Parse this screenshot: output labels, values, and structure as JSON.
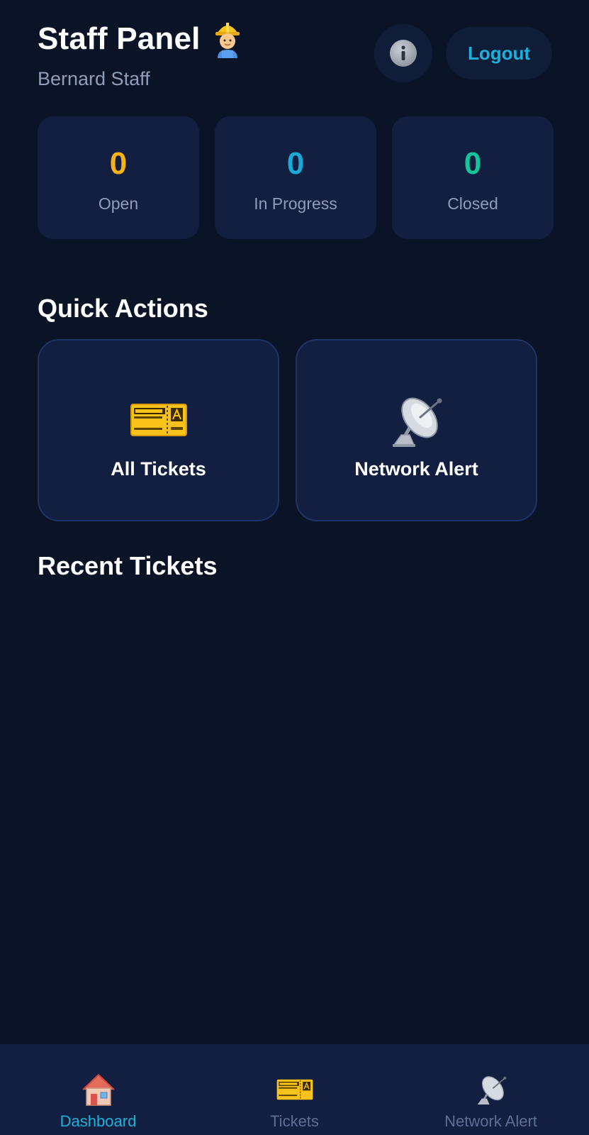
{
  "header": {
    "title": "Staff Panel",
    "title_icon": "construction-worker-emoji",
    "subtitle": "Bernard Staff",
    "info_icon": "info-icon",
    "logout_label": "Logout"
  },
  "stats": [
    {
      "value": "0",
      "label": "Open",
      "color": "#f5b315"
    },
    {
      "value": "0",
      "label": "In Progress",
      "color": "#1aa9d6"
    },
    {
      "value": "0",
      "label": "Closed",
      "color": "#14c49a"
    }
  ],
  "quick_actions": {
    "title": "Quick Actions",
    "items": [
      {
        "label": "All Tickets",
        "icon": "ticket-icon"
      },
      {
        "label": "Network Alert",
        "icon": "satellite-dish-icon"
      }
    ]
  },
  "recent_tickets": {
    "title": "Recent Tickets",
    "items": []
  },
  "bottom_nav": {
    "items": [
      {
        "label": "Dashboard",
        "icon": "house-icon",
        "active": true
      },
      {
        "label": "Tickets",
        "icon": "ticket-icon",
        "active": false
      },
      {
        "label": "Network Alert",
        "icon": "satellite-dish-icon",
        "active": false
      }
    ]
  },
  "colors": {
    "background": "#0b1426",
    "card": "#121f40",
    "accent": "#1ab2dd",
    "muted": "#8f9db8"
  }
}
